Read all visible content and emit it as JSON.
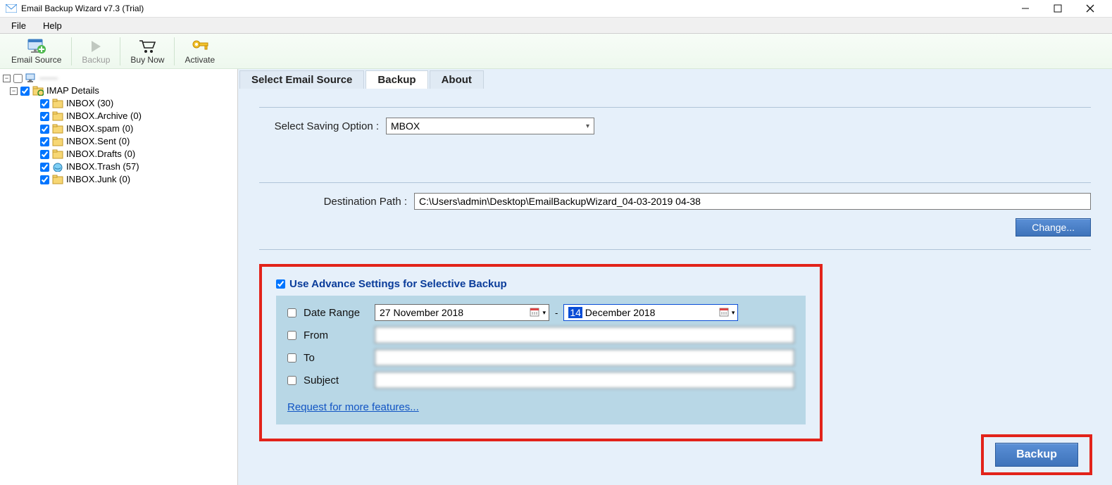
{
  "window": {
    "title": "Email Backup Wizard v7.3 (Trial)"
  },
  "menubar": {
    "file": "File",
    "help": "Help"
  },
  "toolbar": {
    "email_source": "Email Source",
    "backup": "Backup",
    "buy_now": "Buy Now",
    "activate": "Activate"
  },
  "tree": {
    "root_blur": "——",
    "imap": "IMAP Details",
    "items": [
      {
        "label": "INBOX (30)"
      },
      {
        "label": "INBOX.Archive (0)"
      },
      {
        "label": "INBOX.spam (0)"
      },
      {
        "label": "INBOX.Sent (0)"
      },
      {
        "label": "INBOX.Drafts (0)"
      },
      {
        "label": "INBOX.Trash (57)"
      },
      {
        "label": "INBOX.Junk (0)"
      }
    ]
  },
  "tabs": {
    "select_source": "Select Email Source",
    "backup": "Backup",
    "about": "About"
  },
  "form": {
    "saving_option_label": "Select Saving Option  :",
    "saving_option_value": "MBOX",
    "dest_path_label": "Destination Path  :",
    "dest_path_value": "C:\\Users\\admin\\Desktop\\EmailBackupWizard_04-03-2019 04-38",
    "change_btn": "Change..."
  },
  "advance": {
    "header": "Use Advance Settings for Selective Backup",
    "date_range_label": "Date Range",
    "date_from_day": "27",
    "date_from_rest": "  November  2018",
    "date_sep": "-",
    "date_to_day": "14",
    "date_to_rest": "  December  2018",
    "from_label": "From",
    "to_label": "To",
    "subject_label": "Subject",
    "from_ph": "",
    "to_ph": "",
    "subject_ph": "",
    "more_link": "Request for more features..."
  },
  "backup_btn": "Backup"
}
